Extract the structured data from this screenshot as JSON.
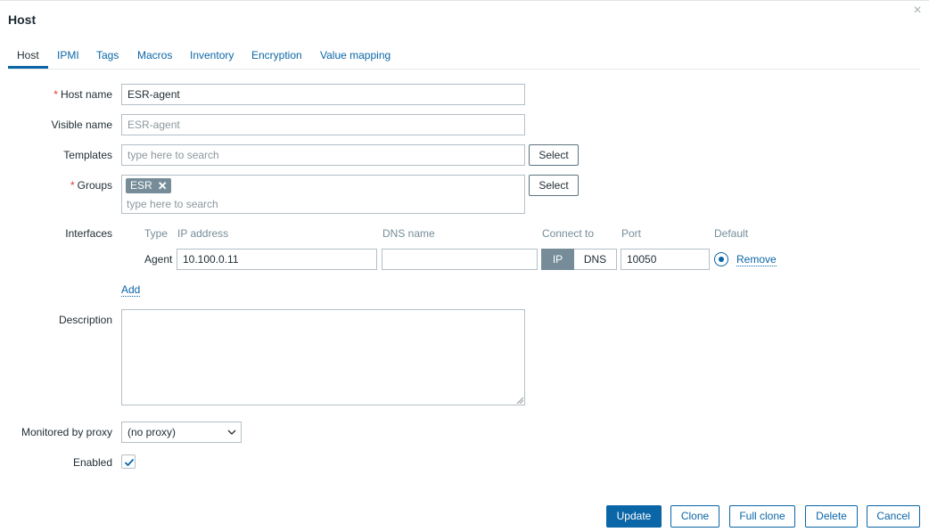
{
  "dialog": {
    "title": "Host",
    "close_icon": "close-icon"
  },
  "tabs": [
    {
      "label": "Host",
      "active": true
    },
    {
      "label": "IPMI"
    },
    {
      "label": "Tags"
    },
    {
      "label": "Macros"
    },
    {
      "label": "Inventory"
    },
    {
      "label": "Encryption"
    },
    {
      "label": "Value mapping"
    }
  ],
  "form": {
    "host_name": {
      "label": "Host name",
      "required": "*",
      "value": "ESR-agent"
    },
    "visible_name": {
      "label": "Visible name",
      "placeholder": "ESR-agent"
    },
    "templates": {
      "label": "Templates",
      "placeholder": "type here to search",
      "select_label": "Select"
    },
    "groups": {
      "label": "Groups",
      "required": "*",
      "chip": "ESR",
      "placeholder": "type here to search",
      "select_label": "Select"
    },
    "interfaces": {
      "label": "Interfaces",
      "headers": {
        "type": "Type",
        "ip": "IP address",
        "dns": "DNS name",
        "connect": "Connect to",
        "port": "Port",
        "default": "Default"
      },
      "rows": [
        {
          "type": "Agent",
          "ip": "10.100.0.11",
          "dns": "",
          "connect_ip": "IP",
          "connect_dns": "DNS",
          "connect_selected": "IP",
          "port": "10050",
          "default": true,
          "remove_label": "Remove"
        }
      ],
      "add_label": "Add"
    },
    "description": {
      "label": "Description",
      "value": ""
    },
    "proxy": {
      "label": "Monitored by proxy",
      "value": "(no proxy)"
    },
    "enabled": {
      "label": "Enabled",
      "checked": true
    }
  },
  "footer": {
    "update": "Update",
    "clone": "Clone",
    "full_clone": "Full clone",
    "delete": "Delete",
    "cancel": "Cancel"
  },
  "colors": {
    "accent": "#0a66a7",
    "required": "#e33734",
    "chip": "#768d99"
  }
}
